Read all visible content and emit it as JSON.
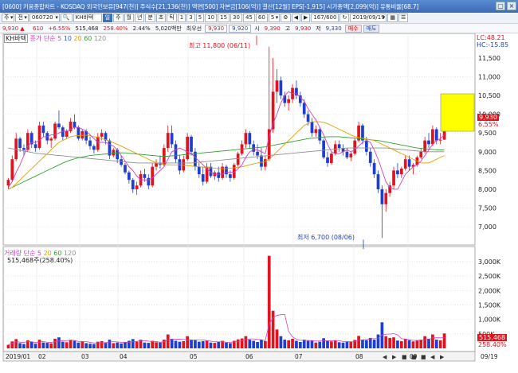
{
  "window": {
    "title": "[0600] 키움종합차트 - KOSDAQ 외국인보유[947(천)] 주식수[21,136(천)] 액면[500] 자본금[106(억)] 결산[12월] EPS[-1,915] 시가총액[2,099(억)] 유통비율[68.7]",
    "buttons": [
      "▢",
      "×"
    ]
  },
  "toolbar": {
    "mode": "주",
    "market": "전",
    "code": "060720",
    "name": "KH바텍",
    "periods": [
      "일",
      "주",
      "월",
      "년",
      "분",
      "초",
      "틱"
    ],
    "selected_period": "일",
    "intervals": [
      "1",
      "3",
      "5",
      "10",
      "15",
      "30",
      "45",
      "60",
      "5"
    ],
    "count": "167/600",
    "date": "2019/09/19"
  },
  "quote": {
    "price": "9,930 ▲",
    "change": "610",
    "rate": "+6.55%",
    "volume": "515,468",
    "vol_rate": "258.40%",
    "turnover": "2.44%",
    "amount": "5,020백만",
    "credit_label": "최우선",
    "ask": "9,930",
    "bid": "9,920",
    "open_label": "시",
    "open": "9,390",
    "high_label": "고",
    "high": "9,930",
    "low_label": "저",
    "low": "9,330",
    "buy": "매수",
    "sell": "매도"
  },
  "price_panel": {
    "tag": "KH바텍",
    "legend": [
      {
        "label": "종가",
        "color": "#d040c0"
      },
      {
        "label": "단순",
        "color": "#d040c0"
      },
      {
        "label": "5",
        "color": "#d040c0"
      },
      {
        "label": "10",
        "color": "#3060e0"
      },
      {
        "label": "20",
        "color": "#e0a000"
      },
      {
        "label": "60",
        "color": "#30a030"
      },
      {
        "label": "120",
        "color": "#909090"
      }
    ],
    "lc": "LC:48.21",
    "hc": "HC:-15.85",
    "high_note": "최고 11,800 (06/11)",
    "low_note": "최저 6,700 (08/06)",
    "last_price": "9,930",
    "last_rate": "6.55%",
    "y_ticks": [
      "11,500",
      "11,000",
      "10,500",
      "10,000",
      "9,500",
      "9,000",
      "8,500",
      "8,000",
      "7,500",
      "7,000"
    ],
    "y_tick_values": [
      11500,
      11000,
      10500,
      10000,
      9500,
      9000,
      8500,
      8000,
      7500,
      7000
    ]
  },
  "volume_panel": {
    "legend": [
      {
        "label": "거래량",
        "color": "#d040c0"
      },
      {
        "label": "단순",
        "color": "#d040c0"
      },
      {
        "label": "5",
        "color": "#d040c0"
      },
      {
        "label": "20",
        "color": "#e0a000"
      },
      {
        "label": "60",
        "color": "#30a030"
      },
      {
        "label": "120",
        "color": "#909090"
      }
    ],
    "info": "515,468주(258.40%)",
    "last_volume": "515,468",
    "last_rate": "258.40%",
    "y_ticks": [
      "3,000K",
      "2,500K",
      "2,000K",
      "1,500K",
      "1,000K",
      "500K"
    ],
    "y_tick_values": [
      3000,
      2500,
      2000,
      1500,
      1000,
      500
    ]
  },
  "x_axis": {
    "labels": [
      "2019/01",
      "02",
      "03",
      "04",
      "05",
      "06",
      "07",
      "08",
      "09"
    ],
    "end_label": "09/19"
  },
  "chart_data": {
    "type": "candlestick",
    "ylim": [
      6600,
      11900
    ],
    "vlim": [
      0,
      3300
    ],
    "candles": [
      [
        8100,
        8300,
        8000,
        8250
      ],
      [
        8250,
        8900,
        8200,
        8800
      ],
      [
        8800,
        9500,
        8750,
        9350
      ],
      [
        9350,
        9400,
        9000,
        9100
      ],
      [
        9100,
        9200,
        8900,
        9050
      ],
      [
        9050,
        9600,
        9000,
        9500
      ],
      [
        9500,
        9550,
        9100,
        9200
      ],
      [
        9200,
        9300,
        9000,
        9100
      ],
      [
        9100,
        9800,
        9050,
        9700
      ],
      [
        9700,
        9800,
        9400,
        9500
      ],
      [
        9500,
        9550,
        9200,
        9300
      ],
      [
        9300,
        9400,
        9100,
        9350
      ],
      [
        9350,
        9800,
        9300,
        9750
      ],
      [
        9750,
        10100,
        9600,
        9650
      ],
      [
        9650,
        9700,
        9300,
        9400
      ],
      [
        9400,
        9600,
        9350,
        9550
      ],
      [
        9550,
        9900,
        9500,
        9800
      ],
      [
        9800,
        10000,
        9600,
        9650
      ],
      [
        9650,
        9700,
        9300,
        9350
      ],
      [
        9350,
        9600,
        9300,
        9550
      ],
      [
        9550,
        9600,
        9200,
        9300
      ],
      [
        9300,
        9400,
        9050,
        9150
      ],
      [
        9150,
        9200,
        8950,
        9050
      ],
      [
        9050,
        9500,
        9000,
        9400
      ],
      [
        9400,
        9600,
        9300,
        9500
      ],
      [
        9500,
        9550,
        9200,
        9300
      ],
      [
        9300,
        9350,
        8800,
        8900
      ],
      [
        8900,
        9100,
        8850,
        9050
      ],
      [
        9050,
        9100,
        8700,
        8800
      ],
      [
        8800,
        8900,
        8600,
        8650
      ],
      [
        8650,
        8700,
        8400,
        8450
      ],
      [
        8450,
        8500,
        8150,
        8250
      ],
      [
        8250,
        8300,
        7900,
        8000
      ],
      [
        8000,
        8200,
        7850,
        8100
      ],
      [
        8100,
        8500,
        8050,
        8400
      ],
      [
        8400,
        8550,
        8200,
        8300
      ],
      [
        8300,
        8400,
        8000,
        8100
      ],
      [
        8100,
        8700,
        8050,
        8600
      ],
      [
        8600,
        8800,
        8500,
        8700
      ],
      [
        8700,
        8900,
        8550,
        8650
      ],
      [
        8650,
        9200,
        8600,
        9100
      ],
      [
        9100,
        9700,
        9000,
        9500
      ],
      [
        9500,
        9700,
        9100,
        9200
      ],
      [
        9200,
        9300,
        8700,
        8800
      ],
      [
        8800,
        8900,
        8400,
        8500
      ],
      [
        8500,
        8900,
        8450,
        8800
      ],
      [
        8800,
        9500,
        8750,
        9400
      ],
      [
        9400,
        9450,
        8900,
        9000
      ],
      [
        9000,
        9100,
        8500,
        8600
      ],
      [
        8600,
        8700,
        8300,
        8400
      ],
      [
        8400,
        8600,
        8100,
        8200
      ],
      [
        8200,
        8700,
        8150,
        8600
      ],
      [
        8600,
        8700,
        8300,
        8350
      ],
      [
        8350,
        8500,
        8250,
        8450
      ],
      [
        8450,
        8600,
        8200,
        8300
      ],
      [
        8300,
        8700,
        8250,
        8600
      ],
      [
        8600,
        8650,
        8300,
        8400
      ],
      [
        8400,
        8500,
        8200,
        8300
      ],
      [
        8300,
        8700,
        8250,
        8650
      ],
      [
        8650,
        9000,
        8600,
        8950
      ],
      [
        8950,
        9300,
        8900,
        9200
      ],
      [
        9200,
        9600,
        9100,
        9500
      ],
      [
        9500,
        9550,
        9100,
        9200
      ],
      [
        9200,
        9300,
        8900,
        9000
      ],
      [
        9000,
        9200,
        8800,
        8900
      ],
      [
        8900,
        9100,
        8500,
        8600
      ],
      [
        8600,
        8900,
        8500,
        8800
      ],
      [
        8800,
        11800,
        8750,
        9600
      ],
      [
        9600,
        11500,
        9500,
        10600
      ],
      [
        10600,
        11200,
        10300,
        10900
      ],
      [
        10900,
        11000,
        10400,
        10500
      ],
      [
        10500,
        10600,
        10200,
        10300
      ],
      [
        10300,
        10500,
        10100,
        10400
      ],
      [
        10400,
        10800,
        10300,
        10700
      ],
      [
        10700,
        10900,
        10400,
        10500
      ],
      [
        10500,
        10600,
        10200,
        10300
      ],
      [
        10300,
        10400,
        9900,
        10000
      ],
      [
        10000,
        10100,
        9700,
        9800
      ],
      [
        9800,
        9900,
        9400,
        9500
      ],
      [
        9500,
        9700,
        9400,
        9600
      ],
      [
        9600,
        9650,
        9200,
        9300
      ],
      [
        9300,
        9350,
        8800,
        8850
      ],
      [
        8850,
        9000,
        8600,
        8700
      ],
      [
        8700,
        9000,
        8650,
        8950
      ],
      [
        8950,
        9300,
        8900,
        9200
      ],
      [
        9200,
        9300,
        9000,
        9100
      ],
      [
        9100,
        9200,
        8900,
        9000
      ],
      [
        9000,
        9100,
        8800,
        8850
      ],
      [
        8850,
        9000,
        8750,
        8950
      ],
      [
        8950,
        9350,
        8900,
        9300
      ],
      [
        9300,
        9800,
        9250,
        9700
      ],
      [
        9700,
        9750,
        9200,
        9300
      ],
      [
        9300,
        9400,
        8900,
        9000
      ],
      [
        9000,
        9100,
        8600,
        8700
      ],
      [
        8700,
        8800,
        8300,
        8400
      ],
      [
        8400,
        8500,
        7900,
        8000
      ],
      [
        8000,
        8100,
        6700,
        7600
      ],
      [
        7600,
        8000,
        7400,
        7900
      ],
      [
        7900,
        8200,
        7800,
        8100
      ],
      [
        8100,
        8600,
        8000,
        8500
      ],
      [
        8500,
        8700,
        8300,
        8400
      ],
      [
        8400,
        8600,
        8300,
        8550
      ],
      [
        8550,
        8900,
        8500,
        8800
      ],
      [
        8800,
        8900,
        8500,
        8600
      ],
      [
        8600,
        8700,
        8400,
        8650
      ],
      [
        8650,
        8900,
        8600,
        8850
      ],
      [
        8850,
        9100,
        8800,
        9000
      ],
      [
        9000,
        9400,
        8950,
        9300
      ],
      [
        9300,
        9500,
        9100,
        9200
      ],
      [
        9200,
        9700,
        9150,
        9600
      ],
      [
        9600,
        9650,
        9200,
        9300
      ],
      [
        9300,
        9500,
        9200,
        9320
      ],
      [
        9320,
        9930,
        9330,
        9930
      ]
    ],
    "ma5": [
      8050,
      8200,
      8450,
      8650,
      8900,
      9150,
      9250,
      9250,
      9300,
      9400,
      9400,
      9450,
      9450,
      9500,
      9550,
      9550,
      9600,
      9650,
      9650,
      9600,
      9550,
      9450,
      9350,
      9250,
      9250,
      9250,
      9200,
      9150,
      9050,
      8900,
      8750,
      8600,
      8500,
      8350,
      8250,
      8250,
      8250,
      8300,
      8400,
      8500,
      8600,
      8800,
      9000,
      9050,
      9100,
      9050,
      9000,
      8950,
      8850,
      8750,
      8650,
      8550,
      8450,
      8400,
      8400,
      8400,
      8450,
      8450,
      8450,
      8550,
      8650,
      8850,
      9000,
      9050,
      9050,
      9000,
      8950,
      9400,
      9750,
      10000,
      10300,
      10500,
      10600,
      10550,
      10550,
      10450,
      10350,
      10150,
      10000,
      9850,
      9650,
      9450,
      9200,
      9000,
      8950,
      8950,
      9000,
      9050,
      9000,
      9050,
      9150,
      9250,
      9300,
      9250,
      9050,
      8800,
      8500,
      8200,
      8050,
      8000,
      8000,
      8200,
      8400,
      8500,
      8600,
      8650,
      8750,
      8900,
      9050,
      9200,
      9300,
      9350,
      9450
    ],
    "ma20": [
      8000,
      8050,
      8150,
      8250,
      8350,
      8450,
      8550,
      8650,
      8750,
      8850,
      8950,
      9050,
      9150,
      9250,
      9300,
      9350,
      9400,
      9420,
      9430,
      9440,
      9440,
      9430,
      9400,
      9380,
      9350,
      9320,
      9280,
      9240,
      9200,
      9150,
      9100,
      9050,
      9000,
      8950,
      8900,
      8850,
      8800,
      8750,
      8700,
      8680,
      8660,
      8650,
      8650,
      8650,
      8650,
      8640,
      8630,
      8620,
      8610,
      8600,
      8590,
      8580,
      8570,
      8560,
      8550,
      8550,
      8550,
      8560,
      8570,
      8580,
      8600,
      8620,
      8650,
      8680,
      8700,
      8720,
      8740,
      8800,
      8900,
      9000,
      9100,
      9200,
      9300,
      9400,
      9500,
      9600,
      9700,
      9750,
      9800,
      9800,
      9800,
      9780,
      9750,
      9700,
      9650,
      9600,
      9550,
      9500,
      9450,
      9400,
      9380,
      9360,
      9340,
      9320,
      9300,
      9250,
      9200,
      9150,
      9100,
      9050,
      9000,
      8950,
      8900,
      8850,
      8800,
      8750,
      8700,
      8700,
      8700,
      8750,
      8800,
      8850,
      8900
    ],
    "ma60": [
      8000,
      8050,
      8100,
      8150,
      8200,
      8250,
      8300,
      8350,
      8400,
      8450,
      8500,
      8550,
      8600,
      8650,
      8700,
      8740,
      8780,
      8810,
      8840,
      8860,
      8880,
      8900,
      8910,
      8920,
      8930,
      8940,
      8950,
      8960,
      8970,
      8970,
      8970,
      8960,
      8950,
      8940,
      8930,
      8920,
      8910,
      8900,
      8890,
      8880,
      8880,
      8880,
      8890,
      8900,
      8910,
      8920,
      8930,
      8940,
      8950,
      8960,
      8970,
      8980,
      8990,
      9000,
      9010,
      9020,
      9030,
      9040,
      9050,
      9060,
      9070,
      9080,
      9090,
      9100,
      9110,
      9120,
      9130,
      9150,
      9170,
      9190,
      9210,
      9230,
      9250,
      9270,
      9290,
      9310,
      9330,
      9350,
      9360,
      9370,
      9380,
      9390,
      9400,
      9400,
      9400,
      9400,
      9390,
      9380,
      9370,
      9360,
      9350,
      9340,
      9330,
      9320,
      9310,
      9300,
      9280,
      9260,
      9240,
      9220,
      9200,
      9180,
      9160,
      9140,
      9120,
      9100,
      9090,
      9080,
      9070,
      9060,
      9050,
      9050,
      9050
    ],
    "ma120": [
      9100,
      9080,
      9060,
      9040,
      9020,
      9000,
      8980,
      8960,
      8950,
      8940,
      8930,
      8920,
      8910,
      8900,
      8890,
      8880,
      8870,
      8860,
      8850,
      8840,
      8830,
      8820,
      8810,
      8800,
      8790,
      8780,
      8770,
      8760,
      8750,
      8740,
      8730,
      8720,
      8710,
      8700,
      8700,
      8700,
      8700,
      8700,
      8700,
      8700,
      8700,
      8700,
      8700,
      8700,
      8700,
      8700,
      8700,
      8700,
      8710,
      8720,
      8730,
      8740,
      8750,
      8760,
      8770,
      8780,
      8790,
      8800,
      8810,
      8820,
      8830,
      8840,
      8850,
      8860,
      8870,
      8880,
      8890,
      8900,
      8910,
      8920,
      8930,
      8940,
      8950,
      8960,
      8970,
      8980,
      8990,
      9000,
      9010,
      9020,
      9030,
      9040,
      9050,
      9060,
      9070,
      9080,
      9090,
      9100,
      9100,
      9100,
      9100,
      9100,
      9100,
      9100,
      9100,
      9100,
      9100,
      9100,
      9090,
      9080,
      9070,
      9060,
      9050,
      9040,
      9030,
      9020,
      9010,
      9000,
      9000,
      9000,
      9000,
      9000,
      9000
    ],
    "volumes": [
      120,
      240,
      320,
      180,
      150,
      280,
      220,
      160,
      300,
      200,
      190,
      170,
      330,
      380,
      230,
      210,
      290,
      260,
      200,
      240,
      180,
      160,
      150,
      230,
      250,
      190,
      300,
      180,
      200,
      170,
      220,
      260,
      320,
      230,
      300,
      200,
      190,
      260,
      210,
      200,
      300,
      480,
      330,
      260,
      230,
      250,
      420,
      300,
      280,
      230,
      250,
      270,
      200,
      190,
      220,
      260,
      200,
      180,
      260,
      310,
      340,
      420,
      300,
      260,
      220,
      300,
      250,
      3200,
      1300,
      650,
      420,
      300,
      280,
      330,
      260,
      220,
      300,
      260,
      280,
      200,
      230,
      350,
      260,
      240,
      280,
      210,
      200,
      230,
      220,
      290,
      430,
      300,
      280,
      360,
      300,
      480,
      900,
      420,
      360,
      380,
      270,
      250,
      330,
      280,
      240,
      270,
      300,
      420,
      330,
      480,
      300,
      280,
      515
    ]
  }
}
